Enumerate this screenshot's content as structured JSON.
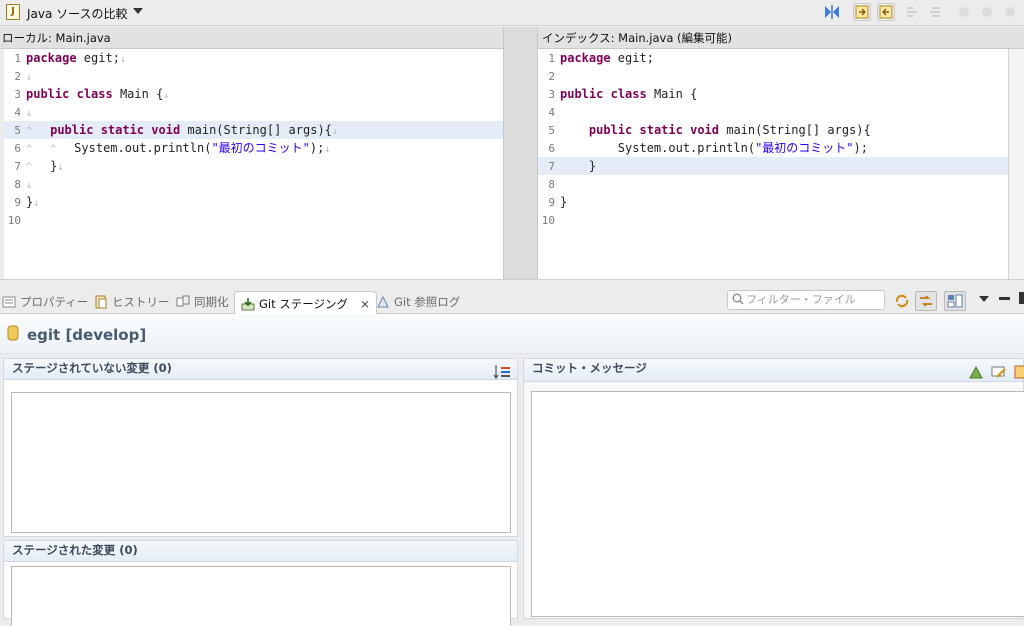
{
  "toolbar": {
    "title": "Java ソースの比較",
    "file_icon_glyph": "J"
  },
  "compare": {
    "left_title": "ローカル: Main.java",
    "right_title": "インデックス: Main.java (編集可能)"
  },
  "left_lines": [
    {
      "num": "1",
      "tokens": [
        {
          "t": "package",
          "c": "kw"
        },
        {
          "t": " egit;",
          "c": ""
        },
        {
          "t": "↓",
          "c": "ws"
        }
      ]
    },
    {
      "num": "2",
      "tokens": [
        {
          "t": "↓",
          "c": "ws"
        }
      ]
    },
    {
      "num": "3",
      "tokens": [
        {
          "t": "public",
          "c": "kw"
        },
        {
          "t": " ",
          "c": ""
        },
        {
          "t": "class",
          "c": "kw"
        },
        {
          "t": " Main {",
          "c": ""
        },
        {
          "t": "↓",
          "c": "ws"
        }
      ]
    },
    {
      "num": "4",
      "tokens": [
        {
          "t": "↓",
          "c": "ws"
        }
      ]
    },
    {
      "num": "5",
      "tokens": [
        {
          "t": "^   ",
          "c": "ws"
        },
        {
          "t": "public",
          "c": "kw"
        },
        {
          "t": " ",
          "c": ""
        },
        {
          "t": "static",
          "c": "kw"
        },
        {
          "t": " ",
          "c": ""
        },
        {
          "t": "void",
          "c": "kw"
        },
        {
          "t": " main(String[] args){",
          "c": ""
        },
        {
          "t": "↓",
          "c": "ws"
        }
      ]
    },
    {
      "num": "6",
      "tokens": [
        {
          "t": "^   ^   ",
          "c": "ws"
        },
        {
          "t": "System.out.println(",
          "c": ""
        },
        {
          "t": "\"最初のコミット\"",
          "c": "str"
        },
        {
          "t": ");",
          "c": ""
        },
        {
          "t": "↓",
          "c": "ws"
        }
      ]
    },
    {
      "num": "7",
      "tokens": [
        {
          "t": "^   ",
          "c": "ws"
        },
        {
          "t": "}",
          "c": ""
        },
        {
          "t": "↓",
          "c": "ws"
        }
      ]
    },
    {
      "num": "8",
      "tokens": [
        {
          "t": "↓",
          "c": "ws"
        }
      ]
    },
    {
      "num": "9",
      "tokens": [
        {
          "t": "}",
          "c": ""
        },
        {
          "t": "↓",
          "c": "ws"
        }
      ]
    },
    {
      "num": "10",
      "tokens": []
    }
  ],
  "right_lines": [
    {
      "num": "1",
      "tokens": [
        {
          "t": "package",
          "c": "kw"
        },
        {
          "t": " egit;",
          "c": ""
        }
      ]
    },
    {
      "num": "2",
      "tokens": []
    },
    {
      "num": "3",
      "tokens": [
        {
          "t": "public",
          "c": "kw"
        },
        {
          "t": " ",
          "c": ""
        },
        {
          "t": "class",
          "c": "kw"
        },
        {
          "t": " Main {",
          "c": ""
        }
      ]
    },
    {
      "num": "4",
      "tokens": []
    },
    {
      "num": "5",
      "tokens": [
        {
          "t": "    ",
          "c": ""
        },
        {
          "t": "public",
          "c": "kw"
        },
        {
          "t": " ",
          "c": ""
        },
        {
          "t": "static",
          "c": "kw"
        },
        {
          "t": " ",
          "c": ""
        },
        {
          "t": "void",
          "c": "kw"
        },
        {
          "t": " main(String[] args){",
          "c": ""
        }
      ]
    },
    {
      "num": "6",
      "tokens": [
        {
          "t": "        System.out.println(",
          "c": ""
        },
        {
          "t": "\"最初のコミット\"",
          "c": "str"
        },
        {
          "t": ");",
          "c": ""
        }
      ]
    },
    {
      "num": "7",
      "tokens": [
        {
          "t": "    }",
          "c": ""
        }
      ]
    },
    {
      "num": "8",
      "tokens": []
    },
    {
      "num": "9",
      "tokens": [
        {
          "t": "}",
          "c": ""
        }
      ]
    },
    {
      "num": "10",
      "tokens": []
    }
  ],
  "tabs": [
    {
      "label": "プロパティー",
      "icon": "properties-icon"
    },
    {
      "label": "ヒストリー",
      "icon": "history-icon"
    },
    {
      "label": "同期化",
      "icon": "synchronize-icon"
    },
    {
      "label": "Git ステージング",
      "icon": "git-staging-icon"
    },
    {
      "label": "Git 参照ログ",
      "icon": "git-reflog-icon"
    }
  ],
  "filter": {
    "placeholder": "フィルター・ファイル"
  },
  "staging": {
    "repo_title": "egit [develop]",
    "unstaged_title": "ステージされていない変更 (0)",
    "staged_title": "ステージされた変更 (0)",
    "commit_title": "コミット・メッセージ"
  },
  "colors": {
    "keyword": "#7f0055",
    "string": "#2a00ff",
    "highlight": "#e4ecf7"
  }
}
